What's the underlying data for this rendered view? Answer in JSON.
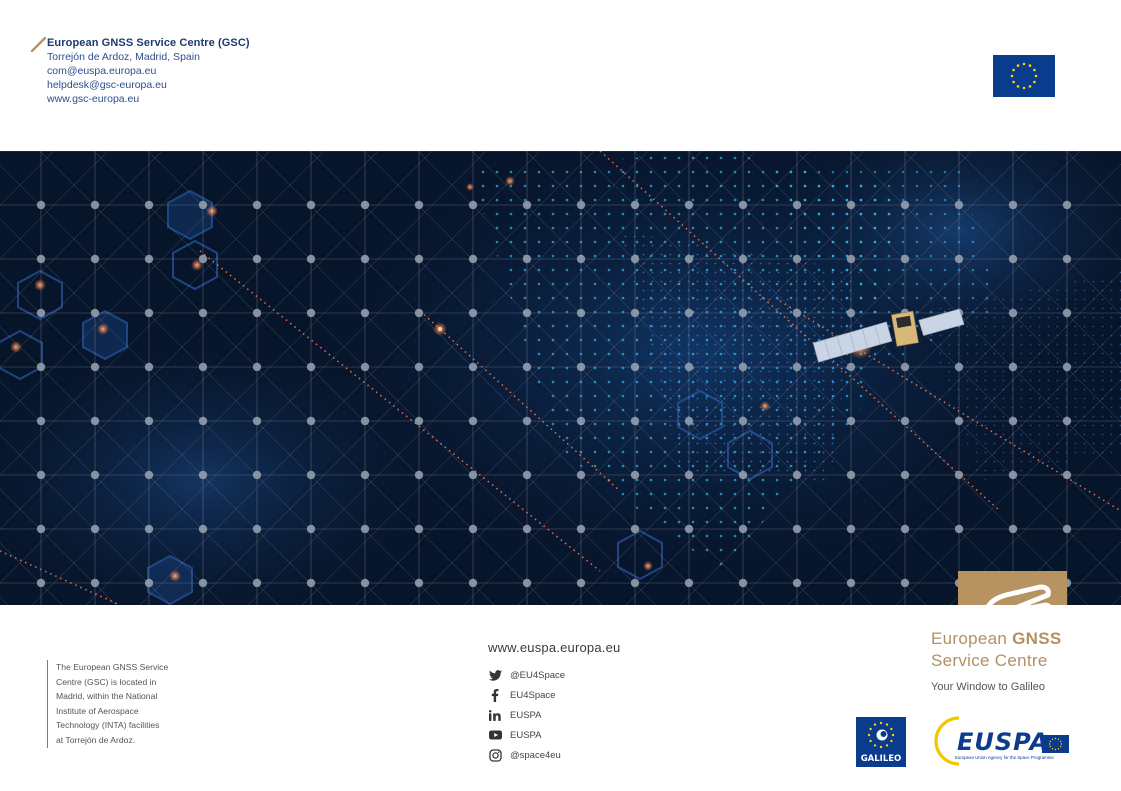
{
  "contact": {
    "org": "European GNSS Service Centre (GSC)",
    "address": "Torrejón de Ardoz, Madrid, Spain",
    "email1": "com@euspa.europa.eu",
    "email2": "helpdesk@gsc-europa.eu",
    "website": "www.gsc-europa.eu"
  },
  "footer": {
    "about": [
      "The European GNSS Service",
      "Centre (GSC) is located in",
      "Madrid, within the National",
      "Institute of Aerospace",
      "Technology (INTA) facilities",
      "at Torrejón de Ardoz."
    ],
    "web": "www.euspa.europa.eu",
    "social": [
      {
        "icon": "twitter-icon",
        "label": "@EU4Space"
      },
      {
        "icon": "facebook-icon",
        "label": "EU4Space"
      },
      {
        "icon": "linkedin-icon",
        "label": "EUSPA"
      },
      {
        "icon": "youtube-icon",
        "label": "EUSPA"
      },
      {
        "icon": "instagram-icon",
        "label": "@space4eu"
      }
    ]
  },
  "brand": {
    "line1_pre": "European ",
    "line1_bold": "GNSS",
    "line2": "Service Centre",
    "tagline": "Your Window to Galileo"
  },
  "logos": {
    "galileo": "GALILEO",
    "euspa": "EUSPA",
    "euspa_sub": "European Union Agency for the Space Programme"
  },
  "colors": {
    "gold": "#b69360",
    "eu_blue": "#0b3b8c",
    "navy_text": "#1d3a70",
    "hero_bg": "#07152b"
  }
}
